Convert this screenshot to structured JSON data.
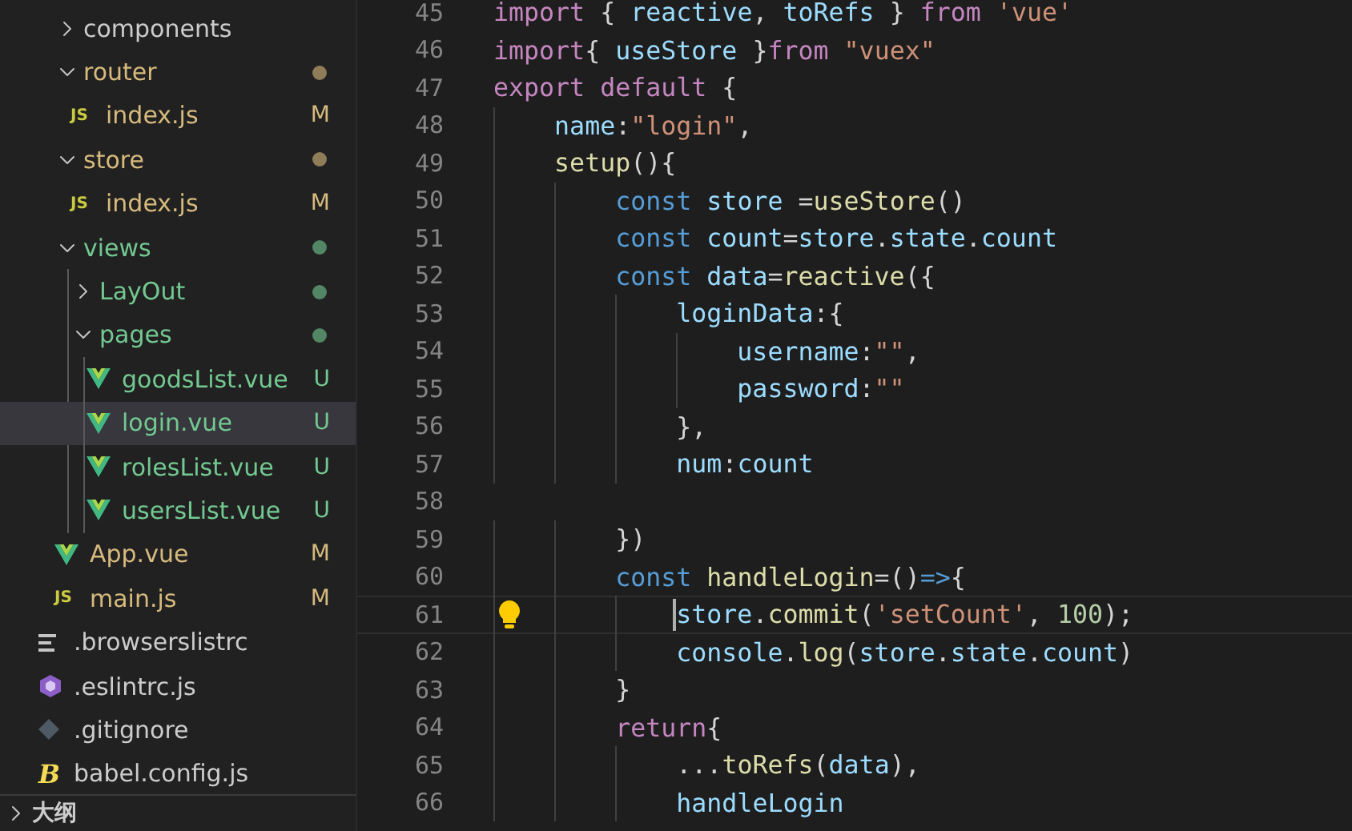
{
  "explorer": {
    "items": [
      {
        "name": "components",
        "kind": "folder",
        "expanded": false,
        "selected": false
      },
      {
        "name": "router",
        "kind": "folder",
        "expanded": true,
        "color": "#d7ba7d",
        "selected": false,
        "children": [
          {
            "name": "index.js",
            "kind": "js",
            "icon_text": "JS",
            "color": "#d7ba7d",
            "badge": "M",
            "selected": false
          }
        ]
      },
      {
        "name": "store",
        "kind": "folder",
        "expanded": true,
        "color": "#d7ba7d",
        "selected": false,
        "children": [
          {
            "name": "index.js",
            "kind": "js",
            "icon_text": "JS",
            "color": "#d7ba7d",
            "badge": "M",
            "selected": false
          }
        ]
      },
      {
        "name": "views",
        "kind": "folder",
        "expanded": true,
        "color": "#73c991",
        "selected": false,
        "children": [
          {
            "name": "LayOut",
            "kind": "folder",
            "expanded": false,
            "color": "#73c991",
            "selected": false
          },
          {
            "name": "pages",
            "kind": "folder",
            "expanded": true,
            "color": "#73c991",
            "selected": false,
            "children": [
              {
                "name": "goodsList.vue",
                "kind": "vue",
                "color": "#73c991",
                "badge": "U",
                "selected": false
              },
              {
                "name": "login.vue",
                "kind": "vue",
                "color": "#73c991",
                "badge": "U",
                "selected": true
              },
              {
                "name": "rolesList.vue",
                "kind": "vue",
                "color": "#73c991",
                "badge": "U",
                "selected": false
              },
              {
                "name": "usersList.vue",
                "kind": "vue",
                "color": "#73c991",
                "badge": "U",
                "selected": false
              }
            ]
          }
        ]
      },
      {
        "name": "App.vue",
        "kind": "vue",
        "color": "#d7ba7d",
        "badge": "M",
        "selected": false
      },
      {
        "name": "main.js",
        "kind": "js",
        "icon_text": "JS",
        "color": "#d7ba7d",
        "badge": "M",
        "selected": false
      }
    ],
    "root_files": [
      {
        "name": ".browserslistrc",
        "kind": "text",
        "selected": false
      },
      {
        "name": ".eslintrc.js",
        "kind": "eslint",
        "selected": false
      },
      {
        "name": ".gitignore",
        "kind": "git",
        "selected": false
      },
      {
        "name": "babel.config.js",
        "kind": "babel",
        "icon_text": "B",
        "selected": false
      }
    ],
    "outline": {
      "title": "大纲",
      "expanded": false
    }
  },
  "editor": {
    "lines": [
      {
        "number": "45",
        "current": false,
        "tokens": [
          {
            "kind": "kw",
            "t": "import"
          },
          {
            "kind": "p",
            "t": " { "
          },
          {
            "kind": "var",
            "t": "reactive"
          },
          {
            "kind": "p",
            "t": ", "
          },
          {
            "kind": "var",
            "t": "toRefs"
          },
          {
            "kind": "p",
            "t": " } "
          },
          {
            "kind": "kw",
            "t": "from "
          },
          {
            "kind": "str",
            "t": "'vue'"
          }
        ]
      },
      {
        "number": "46",
        "current": false,
        "tokens": [
          {
            "kind": "kw",
            "t": "import"
          },
          {
            "kind": "p",
            "t": "{ "
          },
          {
            "kind": "var",
            "t": "useStore"
          },
          {
            "kind": "p",
            "t": " }"
          },
          {
            "kind": "kw",
            "t": "from "
          },
          {
            "kind": "str",
            "t": "\"vuex\""
          }
        ]
      },
      {
        "number": "47",
        "current": false,
        "tokens": [
          {
            "kind": "kw",
            "t": "export default"
          },
          {
            "kind": "p",
            "t": " {"
          }
        ]
      },
      {
        "number": "48",
        "current": false,
        "tokens": [
          {
            "kind": "var",
            "t": "    name"
          },
          {
            "kind": "p",
            "t": ":"
          },
          {
            "kind": "str",
            "t": "\"login\""
          },
          {
            "kind": "p",
            "t": ","
          }
        ]
      },
      {
        "number": "49",
        "current": false,
        "tokens": [
          {
            "kind": "fn",
            "t": "    setup"
          },
          {
            "kind": "p",
            "t": "(){"
          }
        ]
      },
      {
        "number": "50",
        "current": false,
        "tokens": [
          {
            "kind": "decl",
            "t": "        const "
          },
          {
            "kind": "var",
            "t": "store"
          },
          {
            "kind": "p",
            "t": " ="
          },
          {
            "kind": "fn",
            "t": "useStore"
          },
          {
            "kind": "p",
            "t": "()"
          }
        ]
      },
      {
        "number": "51",
        "current": false,
        "tokens": [
          {
            "kind": "decl",
            "t": "        const "
          },
          {
            "kind": "var",
            "t": "count"
          },
          {
            "kind": "p",
            "t": "="
          },
          {
            "kind": "var",
            "t": "store"
          },
          {
            "kind": "p",
            "t": "."
          },
          {
            "kind": "var",
            "t": "state"
          },
          {
            "kind": "p",
            "t": "."
          },
          {
            "kind": "var",
            "t": "count"
          }
        ]
      },
      {
        "number": "52",
        "current": false,
        "tokens": [
          {
            "kind": "decl",
            "t": "        const "
          },
          {
            "kind": "var",
            "t": "data"
          },
          {
            "kind": "p",
            "t": "="
          },
          {
            "kind": "fn",
            "t": "reactive"
          },
          {
            "kind": "p",
            "t": "({"
          }
        ]
      },
      {
        "number": "53",
        "current": false,
        "tokens": [
          {
            "kind": "var",
            "t": "            loginData"
          },
          {
            "kind": "p",
            "t": ":{"
          }
        ]
      },
      {
        "number": "54",
        "current": false,
        "tokens": [
          {
            "kind": "var",
            "t": "                username"
          },
          {
            "kind": "p",
            "t": ":"
          },
          {
            "kind": "str",
            "t": "\"\""
          },
          {
            "kind": "p",
            "t": ","
          }
        ]
      },
      {
        "number": "55",
        "current": false,
        "tokens": [
          {
            "kind": "var",
            "t": "                password"
          },
          {
            "kind": "p",
            "t": ":"
          },
          {
            "kind": "str",
            "t": "\"\""
          }
        ]
      },
      {
        "number": "56",
        "current": false,
        "tokens": [
          {
            "kind": "p",
            "t": "            },"
          }
        ]
      },
      {
        "number": "57",
        "current": false,
        "tokens": [
          {
            "kind": "var",
            "t": "            num"
          },
          {
            "kind": "p",
            "t": ":"
          },
          {
            "kind": "var",
            "t": "count"
          }
        ]
      },
      {
        "number": "58",
        "current": false
      },
      {
        "number": "59",
        "current": false,
        "tokens": [
          {
            "kind": "p",
            "t": "        })"
          }
        ]
      },
      {
        "number": "60",
        "current": false,
        "tokens": [
          {
            "kind": "decl",
            "t": "        const "
          },
          {
            "kind": "fn",
            "t": "handleLogin"
          },
          {
            "kind": "p",
            "t": "=()"
          },
          {
            "kind": "decl",
            "t": "=>"
          },
          {
            "kind": "p",
            "t": "{"
          }
        ]
      },
      {
        "number": "61",
        "current": true,
        "tokens": [
          {
            "kind": "var",
            "t": "            store"
          },
          {
            "kind": "p",
            "t": "."
          },
          {
            "kind": "fn",
            "t": "commit"
          },
          {
            "kind": "p",
            "t": "("
          },
          {
            "kind": "str",
            "t": "'setCount'"
          },
          {
            "kind": "p",
            "t": ", "
          },
          {
            "kind": "num",
            "t": "100"
          },
          {
            "kind": "p",
            "t": ");"
          }
        ]
      },
      {
        "number": "62",
        "current": false,
        "tokens": [
          {
            "kind": "var",
            "t": "            console"
          },
          {
            "kind": "p",
            "t": "."
          },
          {
            "kind": "fn",
            "t": "log"
          },
          {
            "kind": "p",
            "t": "("
          },
          {
            "kind": "var",
            "t": "store"
          },
          {
            "kind": "p",
            "t": "."
          },
          {
            "kind": "var",
            "t": "state"
          },
          {
            "kind": "p",
            "t": "."
          },
          {
            "kind": "var",
            "t": "count"
          },
          {
            "kind": "p",
            "t": ")"
          }
        ]
      },
      {
        "number": "63",
        "current": false,
        "tokens": [
          {
            "kind": "p",
            "t": "        }"
          }
        ]
      },
      {
        "number": "64",
        "current": false,
        "tokens": [
          {
            "kind": "kw",
            "t": "        return"
          },
          {
            "kind": "p",
            "t": "{"
          }
        ]
      },
      {
        "number": "65",
        "current": false,
        "tokens": [
          {
            "kind": "p",
            "t": "            ..."
          },
          {
            "kind": "fn",
            "t": "toRefs"
          },
          {
            "kind": "p",
            "t": "("
          },
          {
            "kind": "var",
            "t": "data"
          },
          {
            "kind": "p",
            "t": "),"
          }
        ]
      },
      {
        "number": "66",
        "current": false,
        "tokens": [
          {
            "kind": "var",
            "t": "            handleLogin"
          }
        ]
      }
    ]
  }
}
